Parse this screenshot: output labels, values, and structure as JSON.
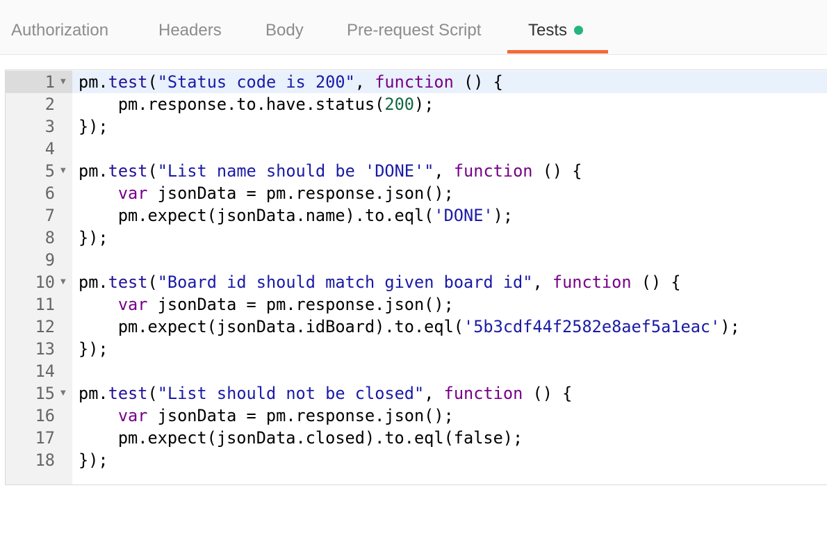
{
  "tabs": [
    {
      "label": "Authorization"
    },
    {
      "label": "Headers"
    },
    {
      "label": "Body"
    },
    {
      "label": "Pre-request Script"
    },
    {
      "label": "Tests",
      "active": true,
      "indicator_color": "#26b47f"
    }
  ],
  "accent_color": "#f26b3a",
  "editor": {
    "lines": [
      {
        "num": "1",
        "foldable": true
      },
      {
        "num": "2"
      },
      {
        "num": "3"
      },
      {
        "num": "4"
      },
      {
        "num": "5",
        "foldable": true
      },
      {
        "num": "6"
      },
      {
        "num": "7"
      },
      {
        "num": "8"
      },
      {
        "num": "9"
      },
      {
        "num": "10",
        "foldable": true
      },
      {
        "num": "11"
      },
      {
        "num": "12"
      },
      {
        "num": "13"
      },
      {
        "num": "14"
      },
      {
        "num": "15",
        "foldable": true
      },
      {
        "num": "16"
      },
      {
        "num": "17"
      },
      {
        "num": "18"
      }
    ],
    "tokens": {
      "pm": "pm",
      "test": "test",
      "func": "function",
      "var": "var",
      "s1": "\"Status code is 200\"",
      "t2a": "pm.response.to.have.status(",
      "n200": "200",
      "t2b": ");",
      "close": "});",
      "s5": "\"List name should be 'DONE'\"",
      "t6": " jsonData = pm.response.json();",
      "t7a": "pm.expect(jsonData.name).to.eql(",
      "s7": "'DONE'",
      "t7b": ");",
      "s10": "\"Board id should match given board id\"",
      "t12a": "pm.expect(jsonData.idBoard).to.eql(",
      "s12": "'5b3cdf44f2582e8aef5a1eac'",
      "t12b": ");",
      "s15": "\"List should not be closed\"",
      "t17": "pm.expect(jsonData.closed).to.eql(false);"
    }
  }
}
